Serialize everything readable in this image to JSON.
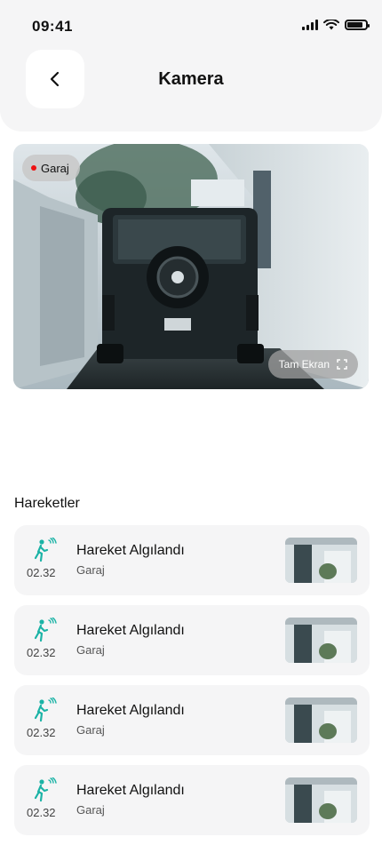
{
  "status_bar": {
    "time": "09:41"
  },
  "header": {
    "title": "Kamera"
  },
  "camera": {
    "location_label": "Garaj",
    "fullscreen_label": "Tam Ekran"
  },
  "events_section": {
    "title": "Hareketler",
    "items": [
      {
        "title": "Hareket Algılandı",
        "location": "Garaj",
        "time": "02.32"
      },
      {
        "title": "Hareket Algılandı",
        "location": "Garaj",
        "time": "02.32"
      },
      {
        "title": "Hareket Algılandı",
        "location": "Garaj",
        "time": "02.32"
      },
      {
        "title": "Hareket Algılandı",
        "location": "Garaj",
        "time": "02.32"
      }
    ]
  },
  "colors": {
    "accent": "#1bb3a6",
    "live": "#ee1111",
    "card_bg": "#f5f5f6"
  },
  "icons": [
    "back-arrow",
    "signal",
    "wifi",
    "battery",
    "motion-sensor",
    "fullscreen"
  ]
}
